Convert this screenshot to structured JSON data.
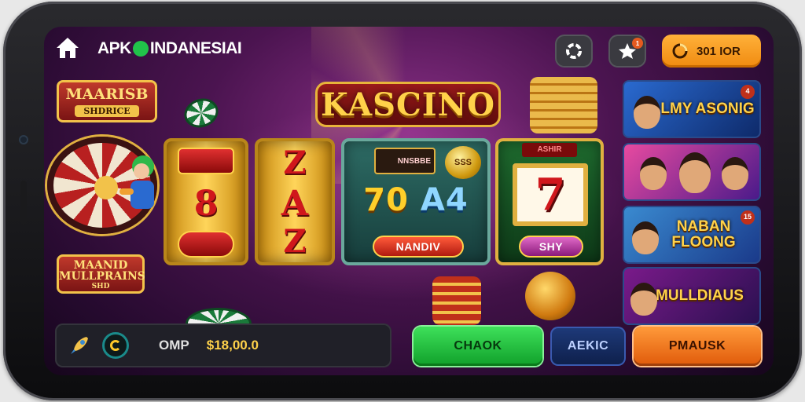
{
  "header": {
    "brand_prefix": "APK",
    "brand_suffix": "INDANESIAI",
    "coin_label": "301 IOR",
    "star_badge": "1"
  },
  "logo": {
    "title": "KASCINO"
  },
  "left_signs": {
    "sign_top": {
      "title": "MAARISB",
      "sub": "SHDRICE"
    },
    "sign_bottom": {
      "title": "MAANID MULLPRAINS",
      "sub": "SHD"
    }
  },
  "reels": {
    "reel_1_symbols": [
      "8"
    ],
    "reel_2_symbols": [
      "Z",
      "A",
      "Z"
    ],
    "reel_3": {
      "top_tag": "NNSBBE",
      "coin": "SSS",
      "line_left": "70",
      "line_right": "A4",
      "button": "NANDIV"
    },
    "reel_4": {
      "top_tag": "ASHIR",
      "seven": "7",
      "button": "SHY"
    }
  },
  "games": [
    {
      "title": "LMY ASONIG",
      "badge": "4"
    },
    {
      "title": "",
      "badge": ""
    },
    {
      "title": "NABAN FLOONG",
      "badge": "15"
    },
    {
      "title": "MULLDIAUS",
      "badge": ""
    }
  ],
  "bottom_bar": {
    "currency": "OMP",
    "balance": "$18,00.0"
  },
  "actions": {
    "green": "CHAOK",
    "blue": "AEKIC",
    "orange": "PMAUSK"
  },
  "colors": {
    "accent_orange": "#f08a0f",
    "accent_green": "#10a02a",
    "background_purple": "#4b1450",
    "gold": "#e0b040"
  },
  "icons": [
    "home-icon",
    "gear-icon",
    "star-icon",
    "coin-icon",
    "rocket-icon",
    "spin-ring-icon"
  ]
}
